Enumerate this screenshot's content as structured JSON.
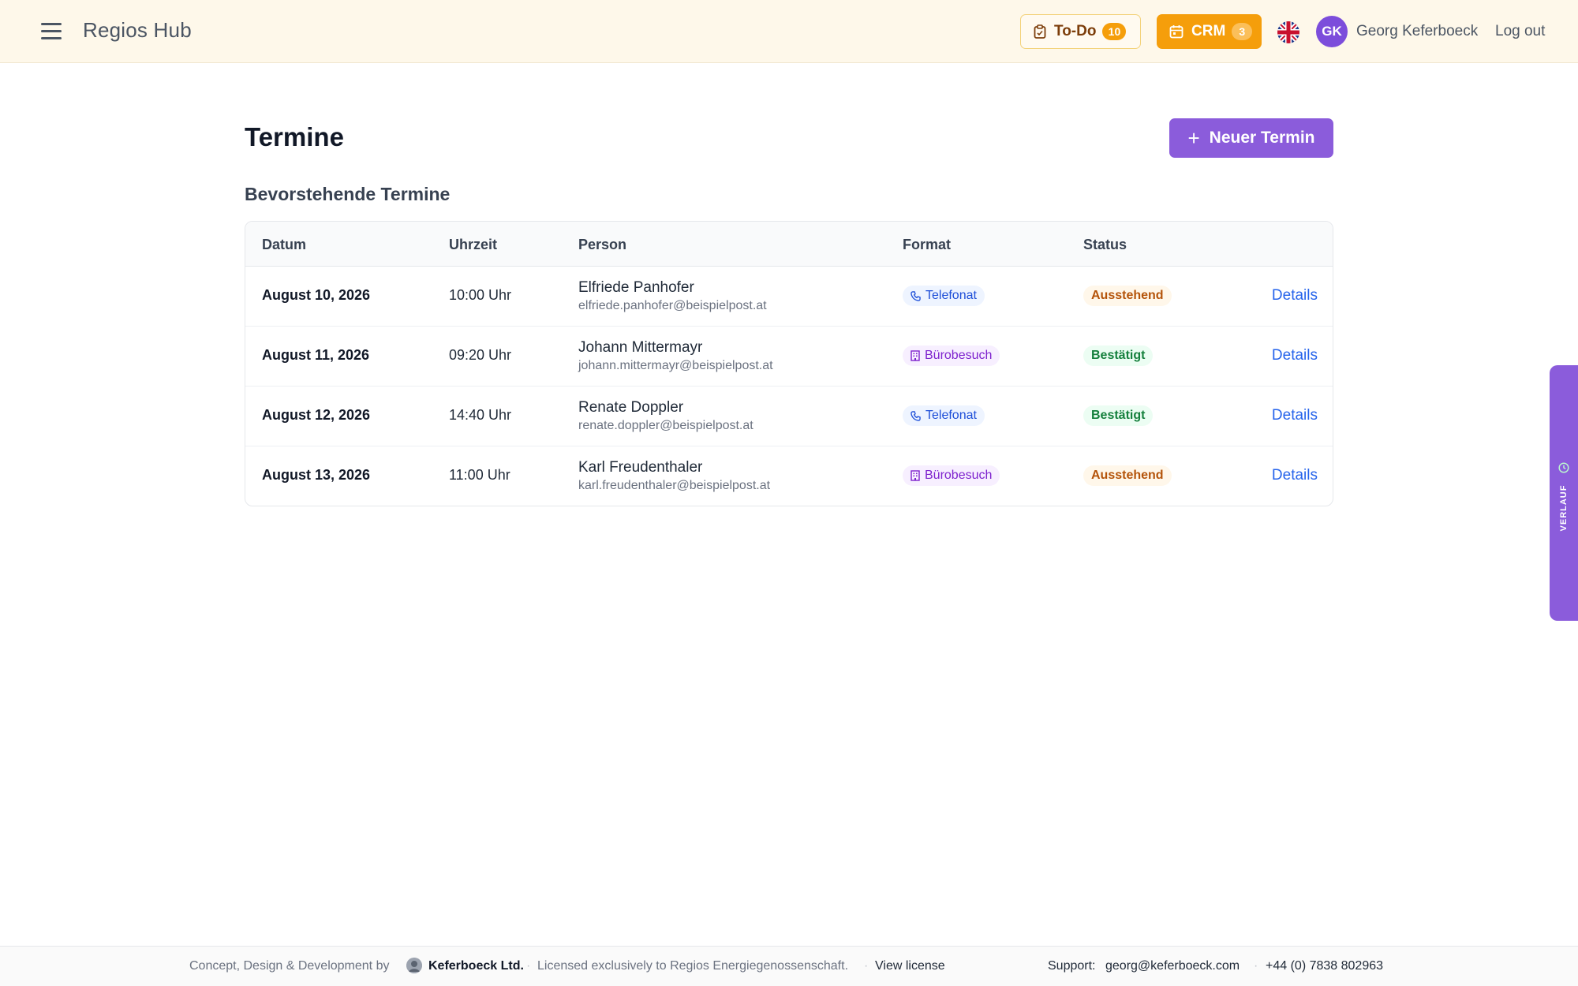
{
  "header": {
    "app_title": "Regios Hub",
    "todo": {
      "label": "To-Do",
      "count": "10"
    },
    "crm": {
      "label": "CRM",
      "count": "3"
    },
    "user": {
      "initials": "GK",
      "name": "Georg Keferboeck"
    },
    "logout_label": "Log out",
    "icons": [
      "menu-icon",
      "clipboard-icon",
      "calendar-icon",
      "uk-flag-icon"
    ]
  },
  "main": {
    "title": "Termine",
    "new_button_label": "Neuer Termin",
    "section_title": "Bevorstehende Termine",
    "columns": [
      "Datum",
      "Uhrzeit",
      "Person",
      "Format",
      "Status"
    ],
    "rows": [
      {
        "date": "August 10, 2026",
        "time": "10:00 Uhr",
        "name": "Elfriede Panhofer",
        "email": "elfriede.panhofer@beispielpost.at",
        "format": "Telefonat",
        "status": "Ausstehend",
        "action": "Details"
      },
      {
        "date": "August 11, 2026",
        "time": "09:20 Uhr",
        "name": "Johann Mittermayr",
        "email": "johann.mittermayr@beispielpost.at",
        "format": "Bürobesuch",
        "status": "Bestätigt",
        "action": "Details"
      },
      {
        "date": "August 12, 2026",
        "time": "14:40 Uhr",
        "name": "Renate Doppler",
        "email": "renate.doppler@beispielpost.at",
        "format": "Telefonat",
        "status": "Bestätigt",
        "action": "Details"
      },
      {
        "date": "August 13, 2026",
        "time": "11:00 Uhr",
        "name": "Karl Freudenthaler",
        "email": "karl.freudenthaler@beispielpost.at",
        "format": "Bürobesuch",
        "status": "Ausstehend",
        "action": "Details"
      }
    ]
  },
  "side_tab": {
    "label": "VERLAUF"
  },
  "footer": {
    "credit_prefix": "Concept, Design & Development by",
    "company": "Keferboeck Ltd.",
    "license_text": "Licensed exclusively to Regios Energiegenossenschaft.",
    "license_link": "View license",
    "support_label": "Support:",
    "support_email": "georg@keferboeck.com",
    "phone": "+44 (0) 7838 802963"
  },
  "colors": {
    "header_bg": "#fef8ea",
    "accent_purple": "#8b5cdb",
    "accent_orange": "#f59e0b",
    "link_blue": "#2563eb",
    "pending": "#b45309",
    "confirmed": "#15803d"
  }
}
